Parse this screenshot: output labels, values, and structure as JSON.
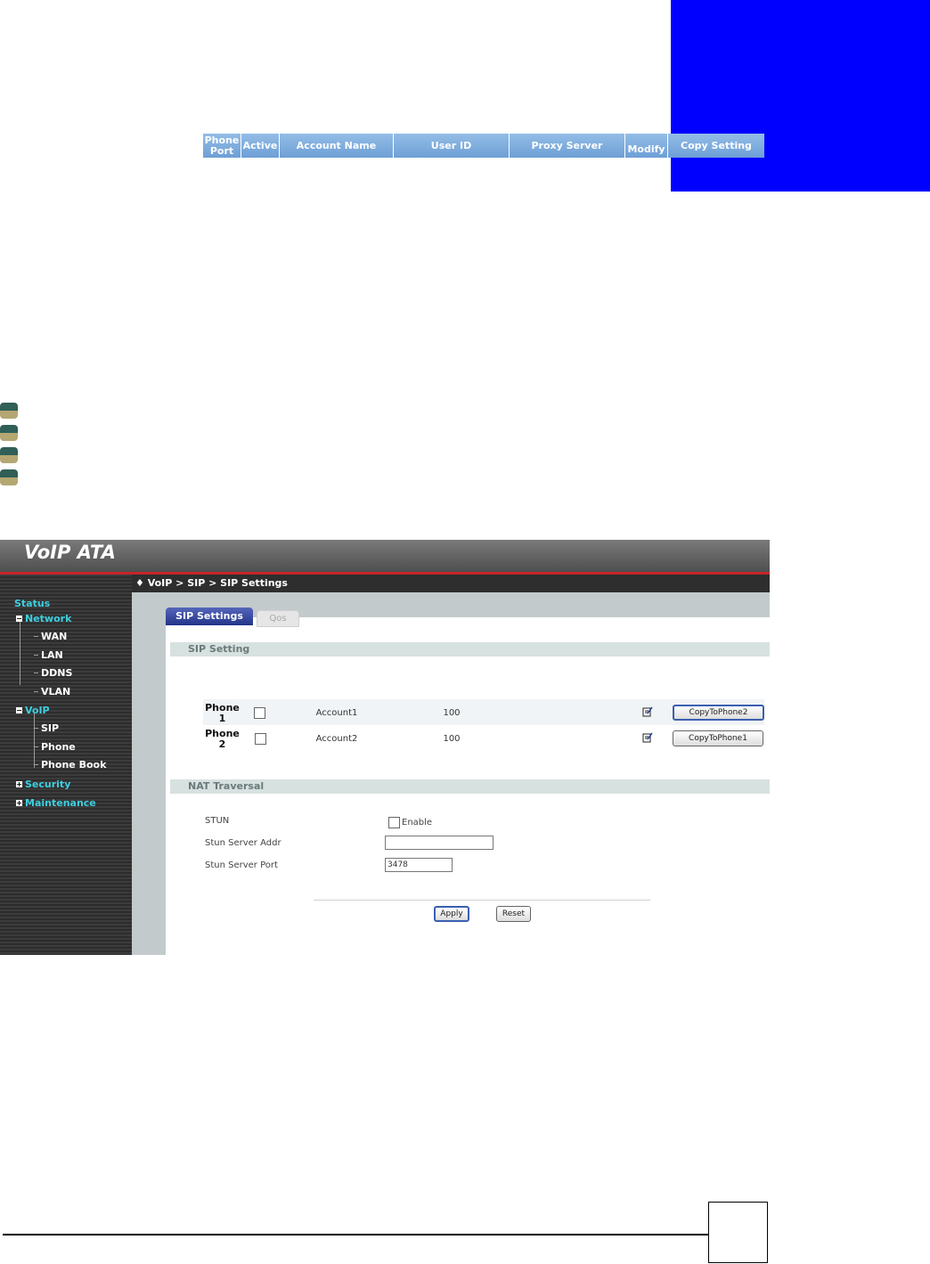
{
  "colors": {
    "accent_blue": "#0000ff",
    "header_red": "#c4252a",
    "nav_cyan": "#3ccfe0",
    "tab_blue": "#23348a"
  },
  "app": {
    "title": "VoIP ATA",
    "breadcrumb": "♦ VoIP > SIP > SIP Settings"
  },
  "sidebar": {
    "items": [
      {
        "label": "Status",
        "expanded": null
      },
      {
        "label": "Network",
        "expanded": true
      },
      {
        "label": "WAN"
      },
      {
        "label": "LAN"
      },
      {
        "label": "DDNS"
      },
      {
        "label": "VLAN"
      },
      {
        "label": "VoIP",
        "expanded": true
      },
      {
        "label": "SIP"
      },
      {
        "label": "Phone"
      },
      {
        "label": "Phone Book"
      },
      {
        "label": "Security",
        "expanded": false
      },
      {
        "label": "Maintenance",
        "expanded": false
      }
    ]
  },
  "tabs": {
    "active": "SIP Settings",
    "inactive": "Qos"
  },
  "sip": {
    "section_title": "SIP Setting",
    "columns": [
      "Phone Port",
      "Active",
      "Account Name",
      "User ID",
      "Proxy Server",
      "Modify",
      "Copy Setting"
    ],
    "rows": [
      {
        "port": "Phone 1",
        "active": false,
        "account": "Account1",
        "user_id": "100",
        "proxy": "",
        "modify_icon": "edit-icon",
        "copy": "CopyToPhone2"
      },
      {
        "port": "Phone 2",
        "active": false,
        "account": "Account2",
        "user_id": "100",
        "proxy": "",
        "modify_icon": "edit-icon",
        "copy": "CopyToPhone1"
      }
    ]
  },
  "nat": {
    "section_title": "NAT Traversal",
    "stun_label": "STUN",
    "stun_enable_label": "Enable",
    "stun_enabled": false,
    "addr_label": "Stun Server Addr",
    "addr_value": "",
    "port_label": "Stun Server Port",
    "port_value": "3478"
  },
  "actions": {
    "apply": "Apply",
    "reset": "Reset"
  }
}
